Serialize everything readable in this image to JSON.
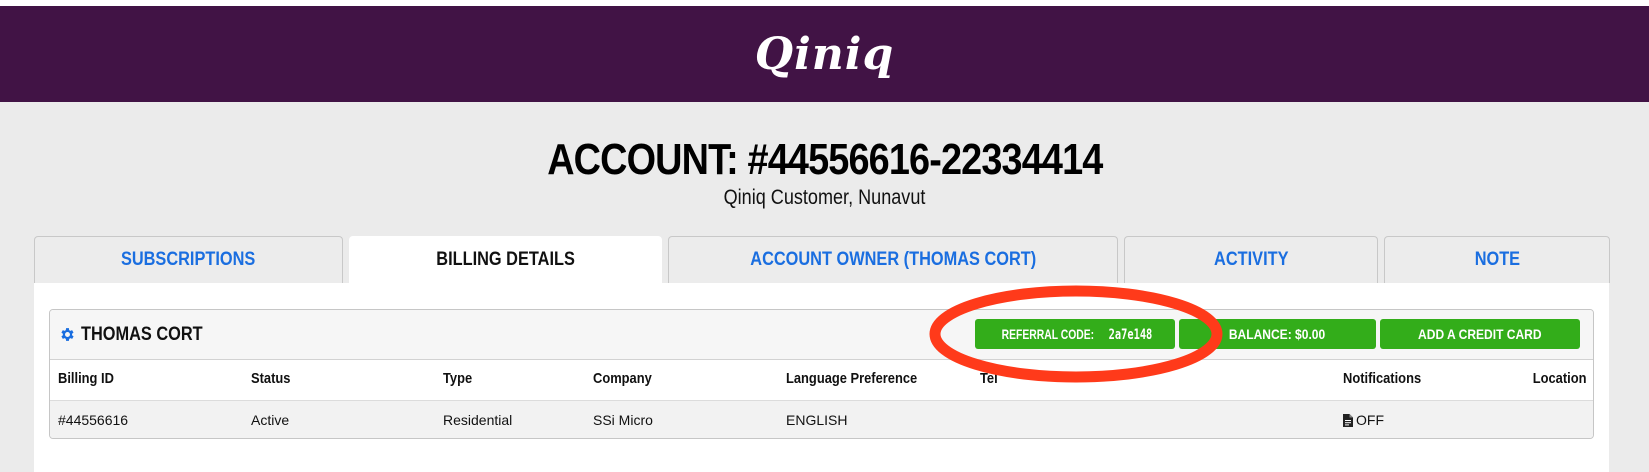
{
  "header": {
    "logo": "Qiniq"
  },
  "account": {
    "title": "ACCOUNT: #44556616-22334414",
    "subtitle": "Qiniq Customer, Nunavut"
  },
  "tabs": [
    {
      "label": "SUBSCRIPTIONS",
      "active": false
    },
    {
      "label": "BILLING DETAILS",
      "active": true
    },
    {
      "label": "ACCOUNT OWNER (THOMAS CORT)",
      "active": false
    },
    {
      "label": "ACTIVITY",
      "active": false
    },
    {
      "label": "NOTE",
      "active": false
    }
  ],
  "billing": {
    "owner_name": "THOMAS CORT",
    "referral_label": "REFERRAL CODE:",
    "referral_code": "2a7e148",
    "balance_label": "BALANCE: $0.00",
    "add_card_label": "ADD A CREDIT CARD",
    "columns": [
      "Billing ID",
      "Status",
      "Type",
      "Company",
      "Language Preference",
      "Tel",
      "Notifications",
      "Location"
    ],
    "rows": [
      {
        "billing_id": "#44556616",
        "status": "Active",
        "type": "Residential",
        "company": "SSi Micro",
        "language": "ENGLISH",
        "tel": "",
        "notifications": "OFF",
        "location": ""
      }
    ]
  },
  "colors": {
    "header_bg": "#411345",
    "tab_link": "#1a6ee0",
    "button_green": "#33ad1a",
    "annotation": "#ff3a1a"
  },
  "icons": {
    "settings": "gear-icon",
    "notifications": "document-icon"
  }
}
